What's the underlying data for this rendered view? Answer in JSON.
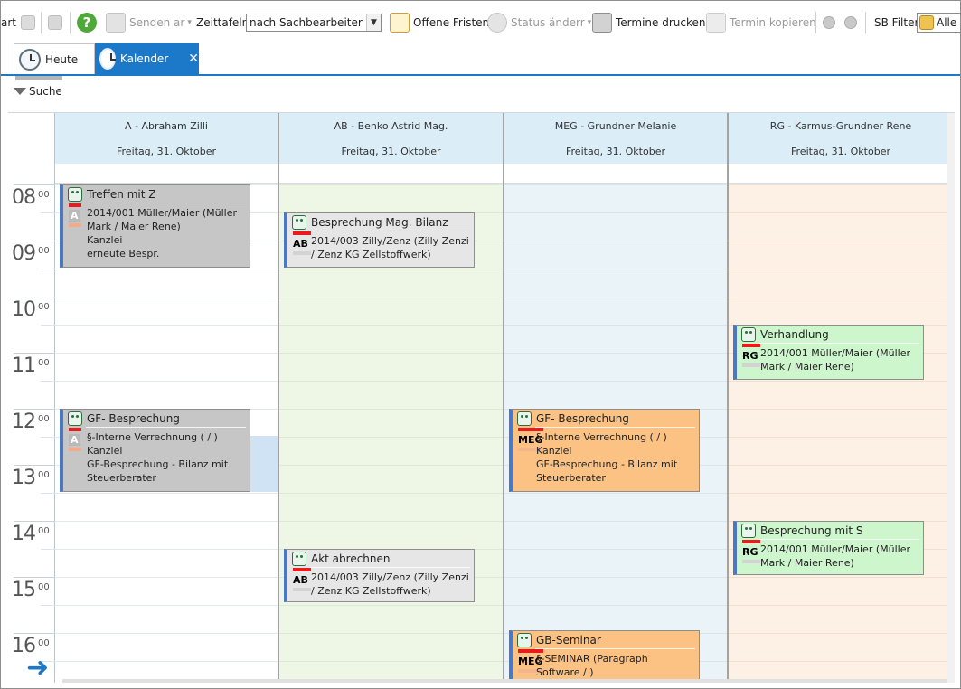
{
  "toolbar": {
    "start_label": "art",
    "senden_label": "Senden ar",
    "zeittafeln_label": "Zeittafeln",
    "zeittafeln_value": "nach Sachbearbeiter",
    "fristen_label": "Offene Fristen",
    "status_label": "Status änderr",
    "drucken_label": "Termine drucken",
    "kopieren_label": "Termin kopieren",
    "filter_label": "SB Filter",
    "filter_value": "Alle"
  },
  "tabs": [
    {
      "label": "Heute"
    },
    {
      "label": "Kalender"
    }
  ],
  "search": {
    "label": "Suche"
  },
  "hours": [
    {
      "h": "08",
      "m": "00"
    },
    {
      "h": "09",
      "m": "00"
    },
    {
      "h": "10",
      "m": "00"
    },
    {
      "h": "11",
      "m": "00"
    },
    {
      "h": "12",
      "m": "00"
    },
    {
      "h": "13",
      "m": "00"
    },
    {
      "h": "14",
      "m": "00"
    },
    {
      "h": "15",
      "m": "00"
    },
    {
      "h": "16",
      "m": "00"
    }
  ],
  "columns": [
    {
      "name": "A - Abraham Zilli",
      "date": "Freitag, 31. Oktober",
      "bg": "#ffffff",
      "line": "#e3e8ec"
    },
    {
      "name": "AB - Benko Astrid Mag.",
      "date": "Freitag, 31. Oktober",
      "bg": "#eef6e6",
      "line": "#dfe8d6"
    },
    {
      "name": "MEG - Grundner Melanie",
      "date": "Freitag, 31. Oktober",
      "bg": "#eaf3f7",
      "line": "#d8e5ec"
    },
    {
      "name": "RG - Karmus-Grundner Rene",
      "date": "Freitag, 31. Oktober",
      "bg": "#fdf0e4",
      "line": "#f0e0d0"
    }
  ],
  "appointments": [
    {
      "col": 0,
      "title": "Treffen mit Z",
      "badge": "A",
      "badge_light": true,
      "color": "#c6c6c6",
      "lines": "2014/001 Müller/Maier (Müller\nMark / Maier Rene)\nKanzlei\nerneute Bespr."
    },
    {
      "col": 1,
      "title": "Besprechung Mag. Bilanz",
      "badge": "AB",
      "badge_light": false,
      "color": "#e6e6e6",
      "lines": "2014/003 Zilly/Zenz (Zilly Zenzi\n/ Zenz KG Zellstoffwerk)"
    },
    {
      "col": 3,
      "title": "Verhandlung",
      "badge": "RG",
      "badge_light": false,
      "color": "#cdf6cd",
      "lines": "2014/001 Müller/Maier (Müller\nMark / Maier Rene)"
    },
    {
      "col": 0,
      "title": "GF- Besprechung",
      "badge": "A",
      "badge_light": true,
      "color": "#c6c6c6",
      "lines": "§-Interne Verrechnung ( / )\nKanzlei\nGF-Besprechung - Bilanz mit\nSteuerberater"
    },
    {
      "col": 2,
      "title": "GF- Besprechung",
      "badge": "MEG",
      "badge_light": false,
      "color": "#fbc283",
      "lines": "§-Interne Verrechnung ( / )\nKanzlei\nGF-Besprechung - Bilanz mit\nSteuerberater"
    },
    {
      "col": 3,
      "title": "Besprechung mit S",
      "badge": "RG",
      "badge_light": false,
      "color": "#cdf6cd",
      "lines": "2014/001 Müller/Maier (Müller\nMark / Maier Rene)"
    },
    {
      "col": 1,
      "title": "Akt abrechnen",
      "badge": "AB",
      "badge_light": false,
      "color": "#e6e6e6",
      "lines": "2014/003 Zilly/Zenz (Zilly Zenzi\n/ Zenz KG Zellstoffwerk)"
    },
    {
      "col": 2,
      "title": "GB-Seminar",
      "badge": "MEG",
      "badge_light": false,
      "color": "#fbc283",
      "lines": "§-SEMINAR (Paragraph\nSoftware / )"
    }
  ],
  "colors": {
    "accent": "#1c78c8",
    "selection": "#cfe3f5"
  }
}
